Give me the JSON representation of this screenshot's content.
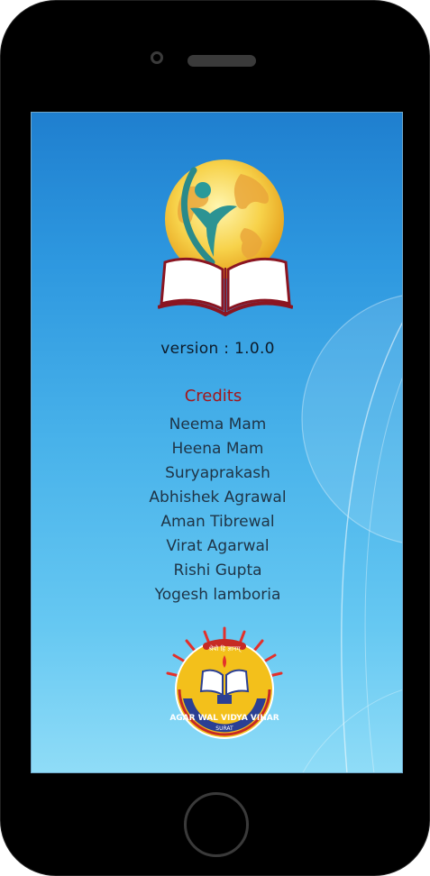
{
  "app": {
    "version_text": "version : 1.0.0"
  },
  "credits": {
    "title": "Credits",
    "names": [
      "Neema Mam",
      "Heena Mam",
      "Suryaprakash",
      "Abhishek Agrawal",
      "Aman Tibrewal",
      "Virat Agarwal",
      "Rishi Gupta",
      "Yogesh lamboria"
    ]
  },
  "school_logo": {
    "motto": "श्रेयो हि ज्ञानम्",
    "name": "AGAR WAL VIDYA VIHAR",
    "city": "SURAT"
  },
  "colors": {
    "screen_top": "#1f7fcf",
    "screen_bottom": "#8fdcf7",
    "credits_title": "#a3171c",
    "credit_name": "#1f3446",
    "phone_body": "#000000"
  },
  "icons": {
    "app_logo": "globe-book-person-icon",
    "school_logo": "school-emblem-icon"
  }
}
